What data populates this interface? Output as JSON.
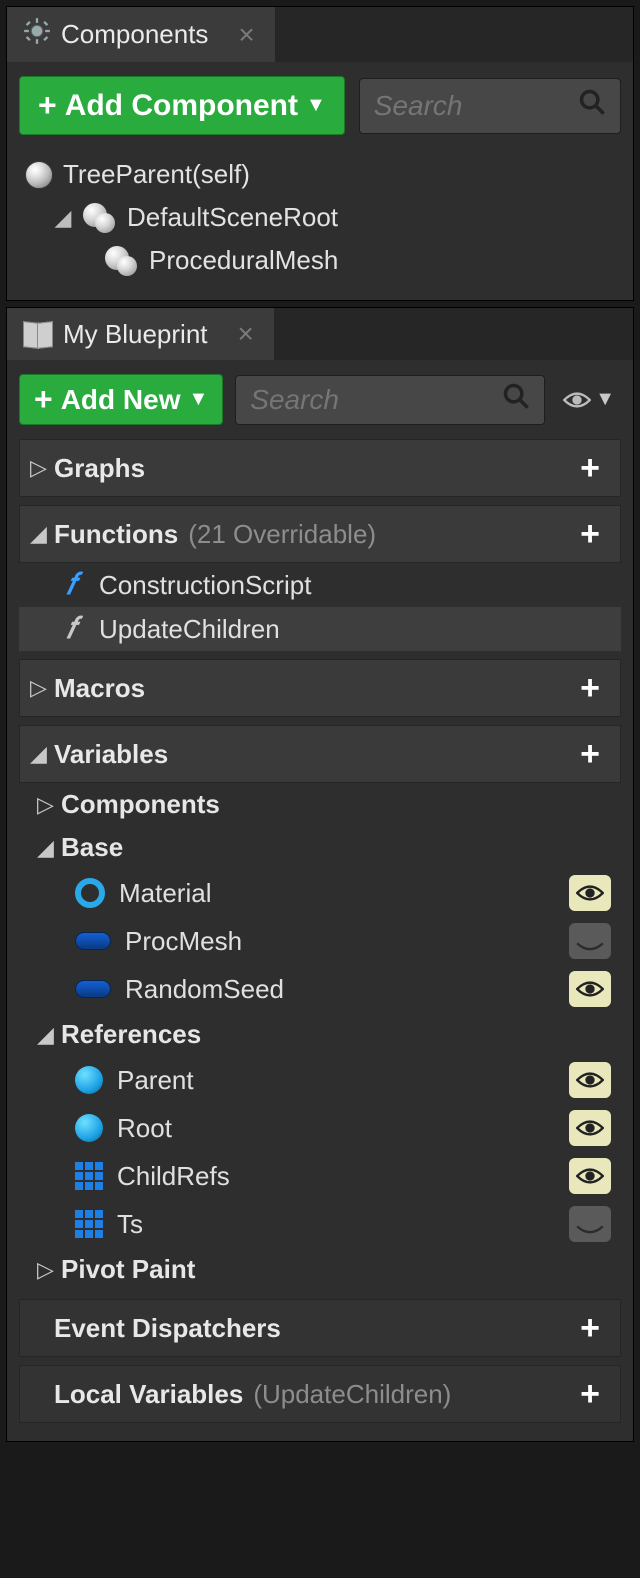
{
  "components_panel": {
    "tab_title": "Components",
    "add_button": "Add Component",
    "search_placeholder": "Search",
    "tree": {
      "root": "TreeParent(self)",
      "scene_root": "DefaultSceneRoot",
      "child1": "ProceduralMesh"
    }
  },
  "blueprint_panel": {
    "tab_title": "My Blueprint",
    "add_button": "Add New",
    "search_placeholder": "Search",
    "sections": {
      "graphs": "Graphs",
      "functions": "Functions",
      "functions_suffix": "(21 Overridable)",
      "macros": "Macros",
      "variables": "Variables",
      "event_dispatchers": "Event Dispatchers",
      "local_variables": "Local Variables",
      "local_variables_suffix": "(UpdateChildren)"
    },
    "functions": {
      "item1": "ConstructionScript",
      "item2": "UpdateChildren"
    },
    "var_groups": {
      "components": "Components",
      "base": "Base",
      "references": "References",
      "pivot_paint": "Pivot Paint"
    },
    "vars": {
      "material": "Material",
      "procmesh": "ProcMesh",
      "randomseed": "RandomSeed",
      "parent": "Parent",
      "root": "Root",
      "childrefs": "ChildRefs",
      "ts": "Ts"
    }
  }
}
